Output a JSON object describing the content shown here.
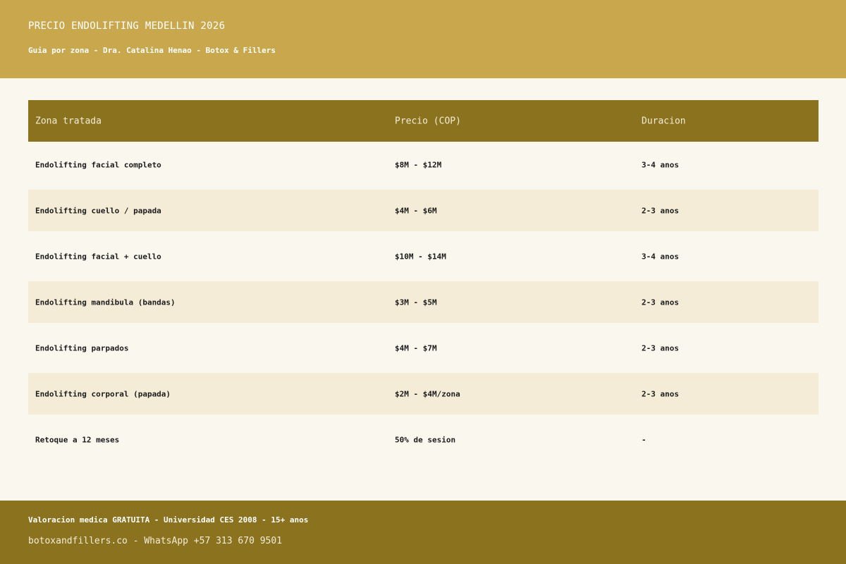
{
  "header": {
    "title": "PRECIO ENDOLIFTING MEDELLIN 2026",
    "subtitle": "Guia por zona - Dra. Catalina Henao - Botox & Fillers"
  },
  "table": {
    "columns": [
      "Zona tratada",
      "Precio (COP)",
      "Duracion"
    ],
    "rows": [
      [
        "Endolifting facial completo",
        "$8M - $12M",
        "3-4 anos"
      ],
      [
        "Endolifting cuello / papada",
        "$4M - $6M",
        "2-3 anos"
      ],
      [
        "Endolifting facial + cuello",
        "$10M - $14M",
        "3-4 anos"
      ],
      [
        "Endolifting mandibula (bandas)",
        "$3M - $5M",
        "2-3 anos"
      ],
      [
        "Endolifting parpados",
        "$4M - $7M",
        "2-3 anos"
      ],
      [
        "Endolifting corporal (papada)",
        "$2M - $4M/zona",
        "2-3 anos"
      ],
      [
        "Retoque a 12 meses",
        "50% de sesion",
        "-"
      ]
    ]
  },
  "footer": {
    "line1": "Valoracion medica GRATUITA - Universidad CES 2008 - 15+ anos",
    "line2": "botoxandfillers.co - WhatsApp +57 313 670 9501"
  },
  "colors": {
    "header_bg": "#c9a84d",
    "table_header_bg": "#8b721e",
    "row_alt_bg": "#f4ecd6",
    "page_bg": "#faf7ef",
    "footer_bg": "#8b721e"
  }
}
